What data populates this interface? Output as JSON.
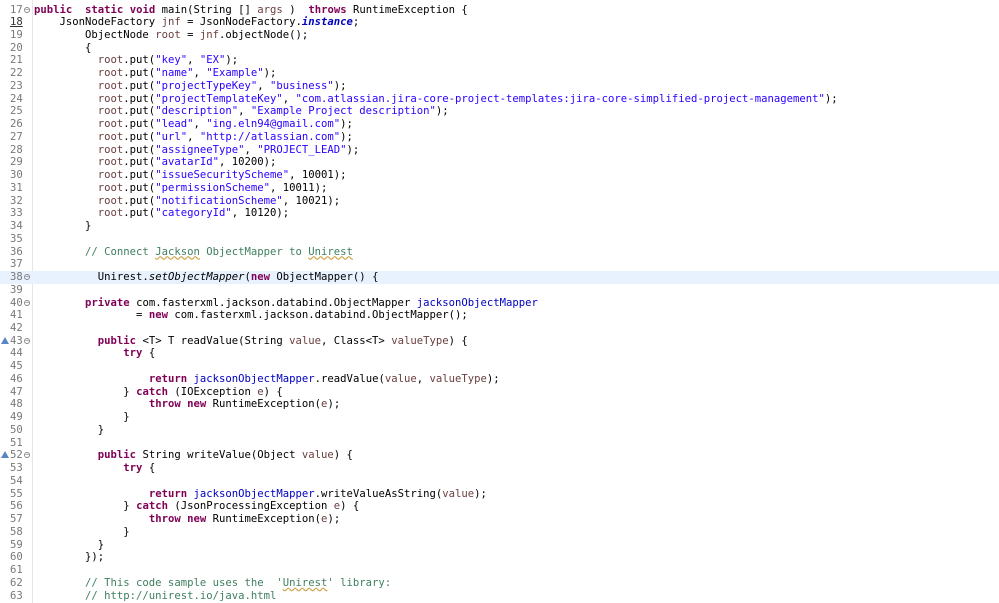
{
  "editor": {
    "lines": [
      {
        "n": "17",
        "m": "fold",
        "s": [
          [
            "kw",
            "public"
          ],
          [
            "",
            "  "
          ],
          [
            "kw",
            "static"
          ],
          [
            "",
            " "
          ],
          [
            "kw",
            "void"
          ],
          [
            "",
            " main(String [] "
          ],
          [
            "par",
            "args"
          ],
          [
            "",
            " )  "
          ],
          [
            "kw",
            "throws"
          ],
          [
            "",
            " RuntimeException {"
          ]
        ]
      },
      {
        "n": "18",
        "cur": true,
        "s": [
          [
            "",
            "    JsonNodeFactory "
          ],
          [
            "par",
            "jnf"
          ],
          [
            "",
            " = JsonNodeFactory."
          ],
          [
            "sti",
            "instance"
          ],
          [
            "",
            ";"
          ]
        ]
      },
      {
        "n": "19",
        "s": [
          [
            "",
            "        ObjectNode "
          ],
          [
            "par",
            "root"
          ],
          [
            "",
            " = "
          ],
          [
            "par",
            "jnf"
          ],
          [
            "",
            ".objectNode();"
          ]
        ]
      },
      {
        "n": "20",
        "s": [
          [
            "",
            "        {"
          ]
        ]
      },
      {
        "n": "21",
        "s": [
          [
            "",
            "          "
          ],
          [
            "par",
            "root"
          ],
          [
            "",
            ".put("
          ],
          [
            "str",
            "\"key\""
          ],
          [
            "",
            ", "
          ],
          [
            "str",
            "\"EX\""
          ],
          [
            "",
            ");"
          ]
        ]
      },
      {
        "n": "22",
        "s": [
          [
            "",
            "          "
          ],
          [
            "par",
            "root"
          ],
          [
            "",
            ".put("
          ],
          [
            "str",
            "\"name\""
          ],
          [
            "",
            ", "
          ],
          [
            "str",
            "\"Example\""
          ],
          [
            "",
            ");"
          ]
        ]
      },
      {
        "n": "23",
        "s": [
          [
            "",
            "          "
          ],
          [
            "par",
            "root"
          ],
          [
            "",
            ".put("
          ],
          [
            "str",
            "\"projectTypeKey\""
          ],
          [
            "",
            ", "
          ],
          [
            "str",
            "\"business\""
          ],
          [
            "",
            ");"
          ]
        ]
      },
      {
        "n": "24",
        "s": [
          [
            "",
            "          "
          ],
          [
            "par",
            "root"
          ],
          [
            "",
            ".put("
          ],
          [
            "str",
            "\"projectTemplateKey\""
          ],
          [
            "",
            ", "
          ],
          [
            "str",
            "\"com.atlassian.jira-core-project-templates:jira-core-simplified-project-management\""
          ],
          [
            "",
            ");"
          ]
        ]
      },
      {
        "n": "25",
        "s": [
          [
            "",
            "          "
          ],
          [
            "par",
            "root"
          ],
          [
            "",
            ".put("
          ],
          [
            "str",
            "\"description\""
          ],
          [
            "",
            ", "
          ],
          [
            "str",
            "\"Example Project description\""
          ],
          [
            "",
            ");"
          ]
        ]
      },
      {
        "n": "26",
        "s": [
          [
            "",
            "          "
          ],
          [
            "par",
            "root"
          ],
          [
            "",
            ".put("
          ],
          [
            "str",
            "\"lead\""
          ],
          [
            "",
            ", "
          ],
          [
            "str",
            "\"ing.eln94@gmail.com\""
          ],
          [
            "",
            ");"
          ]
        ]
      },
      {
        "n": "27",
        "s": [
          [
            "",
            "          "
          ],
          [
            "par",
            "root"
          ],
          [
            "",
            ".put("
          ],
          [
            "str",
            "\"url\""
          ],
          [
            "",
            ", "
          ],
          [
            "str",
            "\"http://atlassian.com\""
          ],
          [
            "",
            ");"
          ]
        ]
      },
      {
        "n": "28",
        "s": [
          [
            "",
            "          "
          ],
          [
            "par",
            "root"
          ],
          [
            "",
            ".put("
          ],
          [
            "str",
            "\"assigneeType\""
          ],
          [
            "",
            ", "
          ],
          [
            "str",
            "\"PROJECT_LEAD\""
          ],
          [
            "",
            ");"
          ]
        ]
      },
      {
        "n": "29",
        "s": [
          [
            "",
            "          "
          ],
          [
            "par",
            "root"
          ],
          [
            "",
            ".put("
          ],
          [
            "str",
            "\"avatarId\""
          ],
          [
            "",
            ", 10200);"
          ]
        ]
      },
      {
        "n": "30",
        "s": [
          [
            "",
            "          "
          ],
          [
            "par",
            "root"
          ],
          [
            "",
            ".put("
          ],
          [
            "str",
            "\"issueSecurityScheme\""
          ],
          [
            "",
            ", 10001);"
          ]
        ]
      },
      {
        "n": "31",
        "s": [
          [
            "",
            "          "
          ],
          [
            "par",
            "root"
          ],
          [
            "",
            ".put("
          ],
          [
            "str",
            "\"permissionScheme\""
          ],
          [
            "",
            ", 10011);"
          ]
        ]
      },
      {
        "n": "32",
        "s": [
          [
            "",
            "          "
          ],
          [
            "par",
            "root"
          ],
          [
            "",
            ".put("
          ],
          [
            "str",
            "\"notificationScheme\""
          ],
          [
            "",
            ", 10021);"
          ]
        ]
      },
      {
        "n": "33",
        "s": [
          [
            "",
            "          "
          ],
          [
            "par",
            "root"
          ],
          [
            "",
            ".put("
          ],
          [
            "str",
            "\"categoryId\""
          ],
          [
            "",
            ", 10120);"
          ]
        ]
      },
      {
        "n": "34",
        "s": [
          [
            "",
            "        }"
          ]
        ]
      },
      {
        "n": "35",
        "s": []
      },
      {
        "n": "36",
        "s": [
          [
            "cm",
            "        // Connect "
          ],
          [
            "cm sq",
            "Jackson"
          ],
          [
            "cm",
            " ObjectMapper to "
          ],
          [
            "cm sq",
            "Unirest"
          ]
        ]
      },
      {
        "n": "37",
        "s": []
      },
      {
        "n": "38",
        "m": "fold",
        "hl": true,
        "s": [
          [
            "",
            "          Unirest."
          ],
          [
            "it",
            "setObjectMapper"
          ],
          [
            "",
            "("
          ],
          [
            "kw",
            "new"
          ],
          [
            "",
            " ObjectMapper() {"
          ]
        ]
      },
      {
        "n": "39",
        "s": []
      },
      {
        "n": "40",
        "m": "fold",
        "s": [
          [
            "",
            "        "
          ],
          [
            "kw",
            "private"
          ],
          [
            "",
            " com.fasterxml.jackson.databind.ObjectMapper "
          ],
          [
            "fld",
            "jacksonObjectMapper"
          ]
        ]
      },
      {
        "n": "41",
        "s": [
          [
            "",
            "                = "
          ],
          [
            "kw",
            "new"
          ],
          [
            "",
            " com.fasterxml.jackson.databind.ObjectMapper();"
          ]
        ]
      },
      {
        "n": "42",
        "s": []
      },
      {
        "n": "43",
        "m": "override",
        "s": [
          [
            "",
            "          "
          ],
          [
            "kw",
            "public"
          ],
          [
            "",
            " <T> T readValue(String "
          ],
          [
            "par",
            "value"
          ],
          [
            "",
            ", Class<T> "
          ],
          [
            "par",
            "valueType"
          ],
          [
            "",
            ") {"
          ]
        ]
      },
      {
        "n": "44",
        "s": [
          [
            "",
            "              "
          ],
          [
            "kw",
            "try"
          ],
          [
            "",
            " {"
          ]
        ]
      },
      {
        "n": "45",
        "s": []
      },
      {
        "n": "46",
        "s": [
          [
            "",
            "                  "
          ],
          [
            "kw",
            "return"
          ],
          [
            "",
            " "
          ],
          [
            "fld",
            "jacksonObjectMapper"
          ],
          [
            "",
            ".readValue("
          ],
          [
            "par",
            "value"
          ],
          [
            "",
            ", "
          ],
          [
            "par",
            "valueType"
          ],
          [
            "",
            ");"
          ]
        ]
      },
      {
        "n": "47",
        "s": [
          [
            "",
            "              } "
          ],
          [
            "kw",
            "catch"
          ],
          [
            "",
            " (IOException "
          ],
          [
            "par",
            "e"
          ],
          [
            "",
            ") {"
          ]
        ]
      },
      {
        "n": "48",
        "s": [
          [
            "",
            "                  "
          ],
          [
            "kw",
            "throw"
          ],
          [
            "",
            " "
          ],
          [
            "kw",
            "new"
          ],
          [
            "",
            " RuntimeException("
          ],
          [
            "par",
            "e"
          ],
          [
            "",
            ");"
          ]
        ]
      },
      {
        "n": "49",
        "s": [
          [
            "",
            "              }"
          ]
        ]
      },
      {
        "n": "50",
        "s": [
          [
            "",
            "          }"
          ]
        ]
      },
      {
        "n": "51",
        "s": []
      },
      {
        "n": "52",
        "m": "override",
        "s": [
          [
            "",
            "          "
          ],
          [
            "kw",
            "public"
          ],
          [
            "",
            " String writeValue(Object "
          ],
          [
            "par",
            "value"
          ],
          [
            "",
            ") {"
          ]
        ]
      },
      {
        "n": "53",
        "s": [
          [
            "",
            "              "
          ],
          [
            "kw",
            "try"
          ],
          [
            "",
            " {"
          ]
        ]
      },
      {
        "n": "54",
        "s": []
      },
      {
        "n": "55",
        "s": [
          [
            "",
            "                  "
          ],
          [
            "kw",
            "return"
          ],
          [
            "",
            " "
          ],
          [
            "fld",
            "jacksonObjectMapper"
          ],
          [
            "",
            ".writeValueAsString("
          ],
          [
            "par",
            "value"
          ],
          [
            "",
            ");"
          ]
        ]
      },
      {
        "n": "56",
        "s": [
          [
            "",
            "              } "
          ],
          [
            "kw",
            "catch"
          ],
          [
            "",
            " (JsonProcessingException "
          ],
          [
            "par",
            "e"
          ],
          [
            "",
            ") {"
          ]
        ]
      },
      {
        "n": "57",
        "s": [
          [
            "",
            "                  "
          ],
          [
            "kw",
            "throw"
          ],
          [
            "",
            " "
          ],
          [
            "kw",
            "new"
          ],
          [
            "",
            " RuntimeException("
          ],
          [
            "par",
            "e"
          ],
          [
            "",
            ");"
          ]
        ]
      },
      {
        "n": "58",
        "s": [
          [
            "",
            "              }"
          ]
        ]
      },
      {
        "n": "59",
        "s": [
          [
            "",
            "          }"
          ]
        ]
      },
      {
        "n": "60",
        "s": [
          [
            "",
            "        });"
          ]
        ]
      },
      {
        "n": "61",
        "s": []
      },
      {
        "n": "62",
        "s": [
          [
            "cm",
            "        // This code sample uses the  '"
          ],
          [
            "cm sq",
            "Unirest"
          ],
          [
            "cm",
            "' library:"
          ]
        ]
      },
      {
        "n": "63",
        "s": [
          [
            "cm",
            "        // http://unirest.io/java.html"
          ]
        ]
      }
    ]
  }
}
